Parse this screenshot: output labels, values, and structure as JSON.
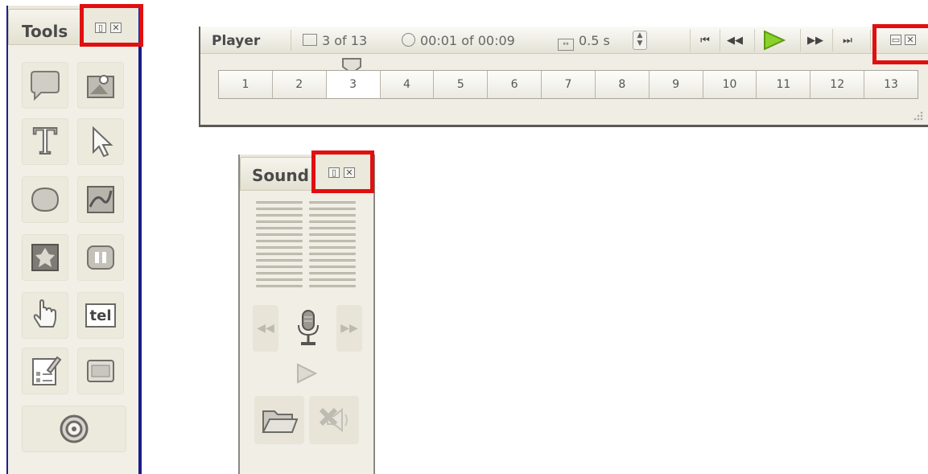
{
  "tools_panel": {
    "title": "Tools",
    "items": [
      {
        "icon": "speech-bubble-icon"
      },
      {
        "icon": "image-icon"
      },
      {
        "icon": "text-icon",
        "glyph": "T"
      },
      {
        "icon": "arrow-cursor-icon"
      },
      {
        "icon": "shape-icon"
      },
      {
        "icon": "picture-frame-icon"
      },
      {
        "icon": "leaf-image-icon"
      },
      {
        "icon": "pause-icon"
      },
      {
        "icon": "hand-pointer-icon"
      },
      {
        "icon": "text-entry-icon",
        "glyph": "tel"
      },
      {
        "icon": "checklist-icon"
      },
      {
        "icon": "window-icon"
      },
      {
        "icon": "target-icon"
      }
    ]
  },
  "player_panel": {
    "title": "Player",
    "frame_info": "3 of 13",
    "time_info": "00:01 of 00:09",
    "duration_info": "0.5 s",
    "frames": [
      "1",
      "2",
      "3",
      "4",
      "5",
      "6",
      "7",
      "8",
      "9",
      "10",
      "11",
      "12",
      "13"
    ],
    "selected_frame": "3"
  },
  "sound_panel": {
    "title": "Sound"
  },
  "colors": {
    "highlight": "#e10f0f",
    "play_green": "#7cc21d",
    "panel_bg": "#f0eee5"
  }
}
